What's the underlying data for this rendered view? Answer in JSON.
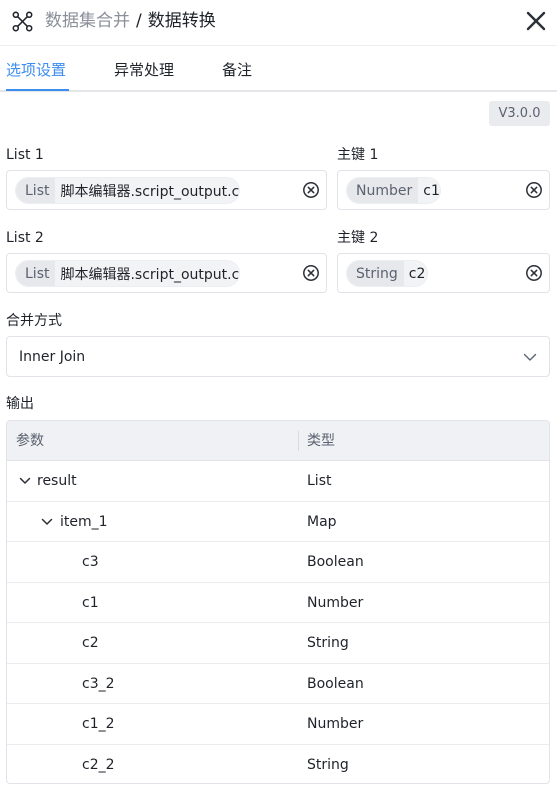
{
  "header": {
    "node_icon": "cross-arrows-icon",
    "parent_title": "数据集合并",
    "separator": "/",
    "current_title": "数据转换",
    "close_icon": "close-icon"
  },
  "tabs": [
    {
      "label": "选项设置",
      "active": true
    },
    {
      "label": "异常处理",
      "active": false
    },
    {
      "label": "备注",
      "active": false
    }
  ],
  "version": "V3.0.0",
  "form": {
    "list1": {
      "label": "List 1",
      "type": "List",
      "value": "脚本编辑器.script_output.c"
    },
    "key1": {
      "label": "主键 1",
      "type": "Number",
      "value": "c1"
    },
    "list2": {
      "label": "List 2",
      "type": "List",
      "value": "脚本编辑器.script_output.c"
    },
    "key2": {
      "label": "主键 2",
      "type": "String",
      "value": "c2"
    },
    "merge": {
      "label": "合并方式",
      "value": "Inner Join"
    }
  },
  "output": {
    "label": "输出",
    "columns": {
      "param": "参数",
      "type": "类型"
    },
    "rows": [
      {
        "name": "result",
        "type": "List",
        "level": 0,
        "expandable": true
      },
      {
        "name": "item_1",
        "type": "Map",
        "level": 1,
        "expandable": true
      },
      {
        "name": "c3",
        "type": "Boolean",
        "level": 2,
        "expandable": false
      },
      {
        "name": "c1",
        "type": "Number",
        "level": 2,
        "expandable": false
      },
      {
        "name": "c2",
        "type": "String",
        "level": 2,
        "expandable": false
      },
      {
        "name": "c3_2",
        "type": "Boolean",
        "level": 2,
        "expandable": false
      },
      {
        "name": "c1_2",
        "type": "Number",
        "level": 2,
        "expandable": false
      },
      {
        "name": "c2_2",
        "type": "String",
        "level": 2,
        "expandable": false
      }
    ]
  },
  "colors": {
    "accent": "#3b8df0",
    "text": "#1f2329",
    "muted": "#8a8f99"
  }
}
